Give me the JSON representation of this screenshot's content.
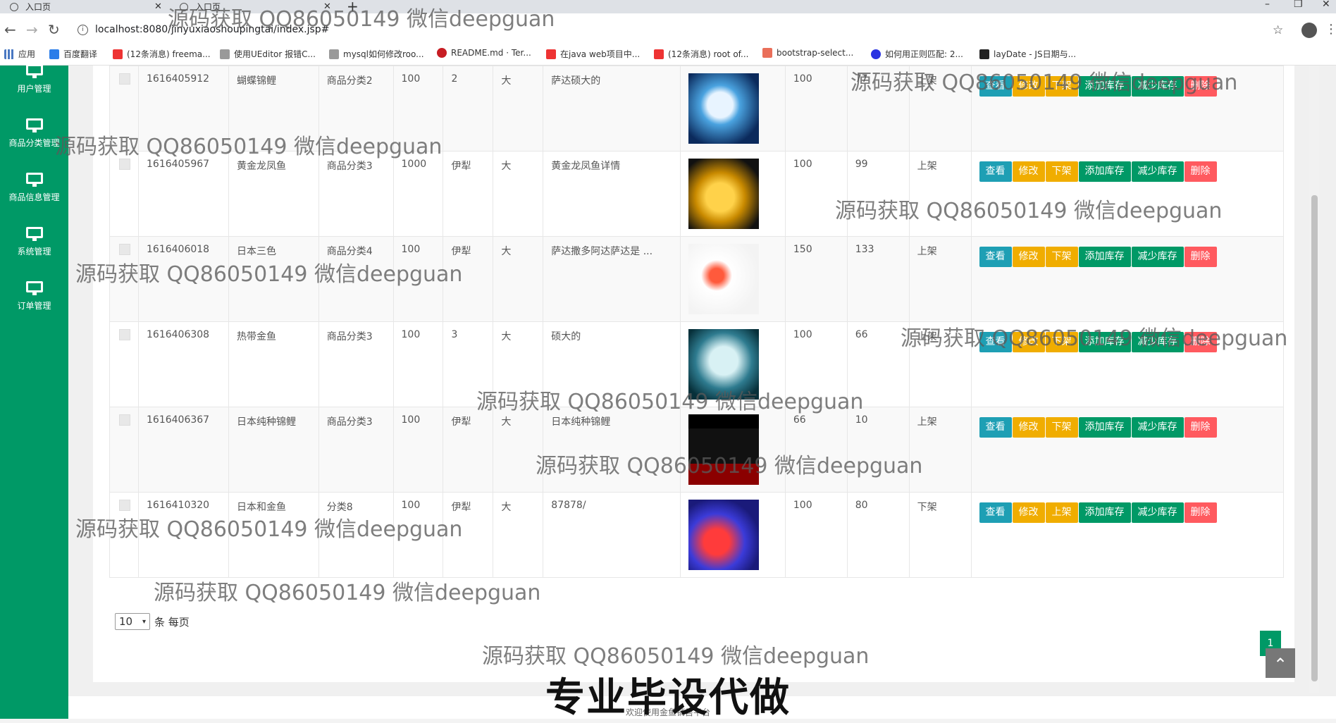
{
  "browser": {
    "tabs": [
      {
        "title": "入口页"
      },
      {
        "title": "入口页"
      }
    ],
    "url": "localhost:8080/jinyuxiaoshoupingtai/index.jsp#",
    "bookmarks": [
      "应用",
      "百度翻译",
      "(12条消息) freema...",
      "使用UEditor 报错C...",
      "mysql如何修改roo...",
      "README.md · Ter...",
      "在java web项目中...",
      "(12条消息) root of...",
      "bootstrap-select...",
      "如何用正则匹配: 2...",
      "layDate - JS日期与..."
    ]
  },
  "sidebar": {
    "items": [
      {
        "label": "用户管理"
      },
      {
        "label": "商品分类管理"
      },
      {
        "label": "商品信息管理"
      },
      {
        "label": "系统管理"
      },
      {
        "label": "订单管理"
      }
    ]
  },
  "table": {
    "rows": [
      {
        "id": "1616405912",
        "name": "蝴蝶锦鲤",
        "category": "商品分类2",
        "price": "100",
        "origin": "2",
        "size": "大",
        "desc": "萨达硕大的",
        "v1": "100",
        "v2": "77",
        "status": "上架",
        "shelf_btn": "下架"
      },
      {
        "id": "1616405967",
        "name": "黄金龙凤鱼",
        "category": "商品分类3",
        "price": "1000",
        "origin": "伊犁",
        "size": "大",
        "desc": "黄金龙凤鱼详情",
        "v1": "100",
        "v2": "99",
        "status": "上架",
        "shelf_btn": "下架"
      },
      {
        "id": "1616406018",
        "name": "日本三色",
        "category": "商品分类4",
        "price": "100",
        "origin": "伊犁",
        "size": "大",
        "desc": "萨达撒多阿达萨达是 ...",
        "v1": "150",
        "v2": "133",
        "status": "上架",
        "shelf_btn": "下架"
      },
      {
        "id": "1616406308",
        "name": "热带金鱼",
        "category": "商品分类3",
        "price": "100",
        "origin": "3",
        "size": "大",
        "desc": "硕大的",
        "v1": "100",
        "v2": "66",
        "status": "上架",
        "shelf_btn": "下架"
      },
      {
        "id": "1616406367",
        "name": "日本纯种锦鲤",
        "category": "商品分类3",
        "price": "100",
        "origin": "伊犁",
        "size": "大",
        "desc": "日本纯种锦鲤",
        "v1": "66",
        "v2": "10",
        "status": "上架",
        "shelf_btn": "下架"
      },
      {
        "id": "1616410320",
        "name": "日本和金鱼",
        "category": "分类8",
        "price": "100",
        "origin": "伊犁",
        "size": "大",
        "desc": "87878/",
        "v1": "100",
        "v2": "80",
        "status": "下架",
        "shelf_btn": "上架"
      }
    ],
    "buttons": {
      "view": "查看",
      "edit": "修改",
      "add_stock": "添加库存",
      "reduce_stock": "减少库存",
      "delete": "删除"
    }
  },
  "pager": {
    "page_size": "10",
    "per_page_label": "条 每页",
    "current_page": "1"
  },
  "footer": {
    "text": "欢迎使用金鱼销售平台"
  },
  "overlay": {
    "banner": "专业毕设代做",
    "watermark": "源码获取 QQ86050149 微信deepguan"
  },
  "colors": {
    "sidebar": "#009966",
    "view": "#1e9fb4",
    "edit": "#f0ad00",
    "stock": "#009966",
    "delete": "#ff5a5f"
  }
}
